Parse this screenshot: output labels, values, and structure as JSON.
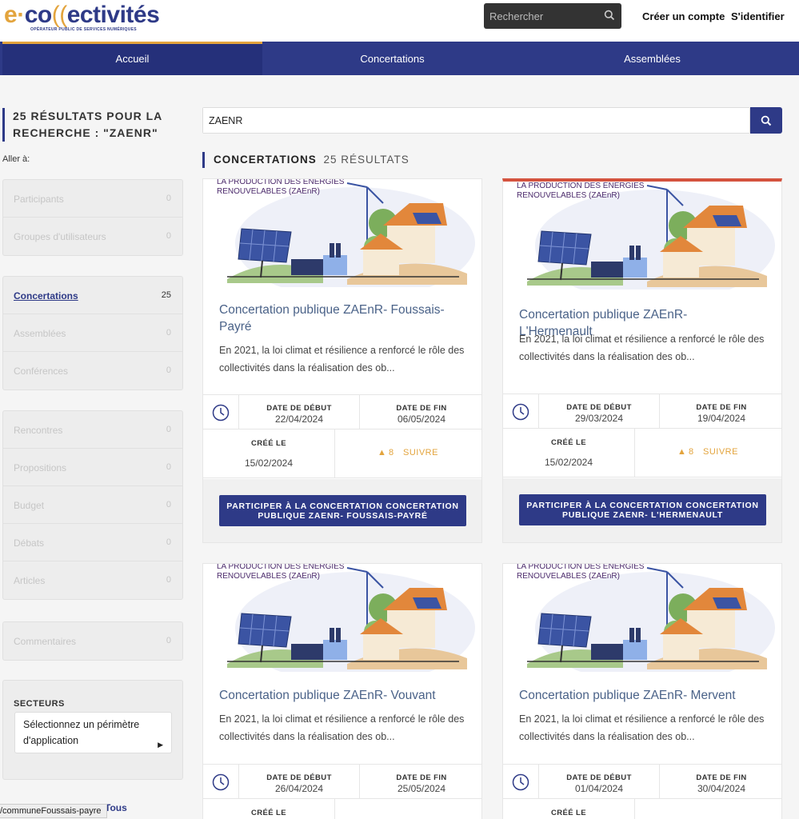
{
  "header": {
    "logo_text": "e-collectivités",
    "logo_tagline": "OPÉRATEUR PUBLIC DE SERVICES NUMÉRIQUES",
    "search_placeholder": "Rechercher",
    "create_account": "Créer un compte",
    "login": "S'identifier"
  },
  "nav": {
    "items": [
      "Accueil",
      "Concertations",
      "Assemblées"
    ],
    "active": "Accueil"
  },
  "sidebar": {
    "results_title": "25 RÉSULTATS POUR LA RECHERCHE : \"ZAENR\"",
    "goto_label": "Aller à:",
    "groups": [
      [
        {
          "label": "Participants",
          "count": "0"
        },
        {
          "label": "Groupes d'utilisateurs",
          "count": "0"
        }
      ],
      [
        {
          "label": "Concertations",
          "count": "25"
        },
        {
          "label": "Assemblées",
          "count": "0"
        },
        {
          "label": "Conférences",
          "count": "0"
        }
      ],
      [
        {
          "label": "Rencontres",
          "count": "0"
        },
        {
          "label": "Propositions",
          "count": "0"
        },
        {
          "label": "Budget",
          "count": "0"
        },
        {
          "label": "Débats",
          "count": "0"
        },
        {
          "label": "Articles",
          "count": "0"
        }
      ],
      [
        {
          "label": "Commentaires",
          "count": "0"
        }
      ]
    ],
    "sectors_title": "SECTEURS",
    "sectors_select": "Sélectionnez un périmètre d'application",
    "bottom_url": "/communeFoussais-payre",
    "bottom_link": "Tous"
  },
  "main": {
    "search_value": "ZAENR",
    "section_title": "CONCERTATIONS",
    "section_count": "25 RÉSULTATS",
    "image_caption_line1": "LA PRODUCTION DES ÉNERGIES",
    "image_caption_line2": "RENOUVELABLES (ZAEnR)",
    "labels": {
      "start": "DATE DE DÉBUT",
      "end": "DATE DE FIN",
      "created": "CRÉÉ LE",
      "follow": "SUIVRE"
    },
    "cards": [
      {
        "title": "Concertation publique ZAEnR- Foussais-Payré",
        "description": "En 2021, la loi climat et résilience a renforcé le rôle des collectivités dans la réalisation des ob...",
        "start_date": "22/04/2024",
        "end_date": "06/05/2024",
        "created": "15/02/2024",
        "followers": "8",
        "button": "PARTICIPER À LA CONCERTATION CONCERTATION PUBLIQUE ZAENR- FOUSSAIS-PAYRÉ"
      },
      {
        "title": "Concertation publique ZAEnR- L'Hermenault",
        "description": "En 2021, la loi climat et résilience a renforcé le rôle des collectivités dans la réalisation des ob...",
        "start_date": "29/03/2024",
        "end_date": "19/04/2024",
        "created": "15/02/2024",
        "followers": "8",
        "button": "PARTICIPER À LA CONCERTATION CONCERTATION PUBLIQUE ZAENR- L'HERMENAULT"
      },
      {
        "title": "Concertation publique ZAEnR- Vouvant",
        "description": "En 2021, la loi climat et résilience a renforcé le rôle des collectivités dans la réalisation des ob...",
        "start_date": "26/04/2024",
        "end_date": "25/05/2024"
      },
      {
        "title": "Concertation publique ZAEnR- Mervent",
        "description": "En 2021, la loi climat et résilience a renforcé le rôle des collectivités dans la réalisation des ob...",
        "start_date": "01/04/2024",
        "end_date": "30/04/2024"
      }
    ]
  },
  "colors": {
    "primary": "#2e3a87",
    "accent": "#e3a43d",
    "flag": "#d4533e"
  },
  "icons": [
    "search-icon",
    "clock-icon",
    "bell-icon",
    "chevron-right-icon"
  ]
}
